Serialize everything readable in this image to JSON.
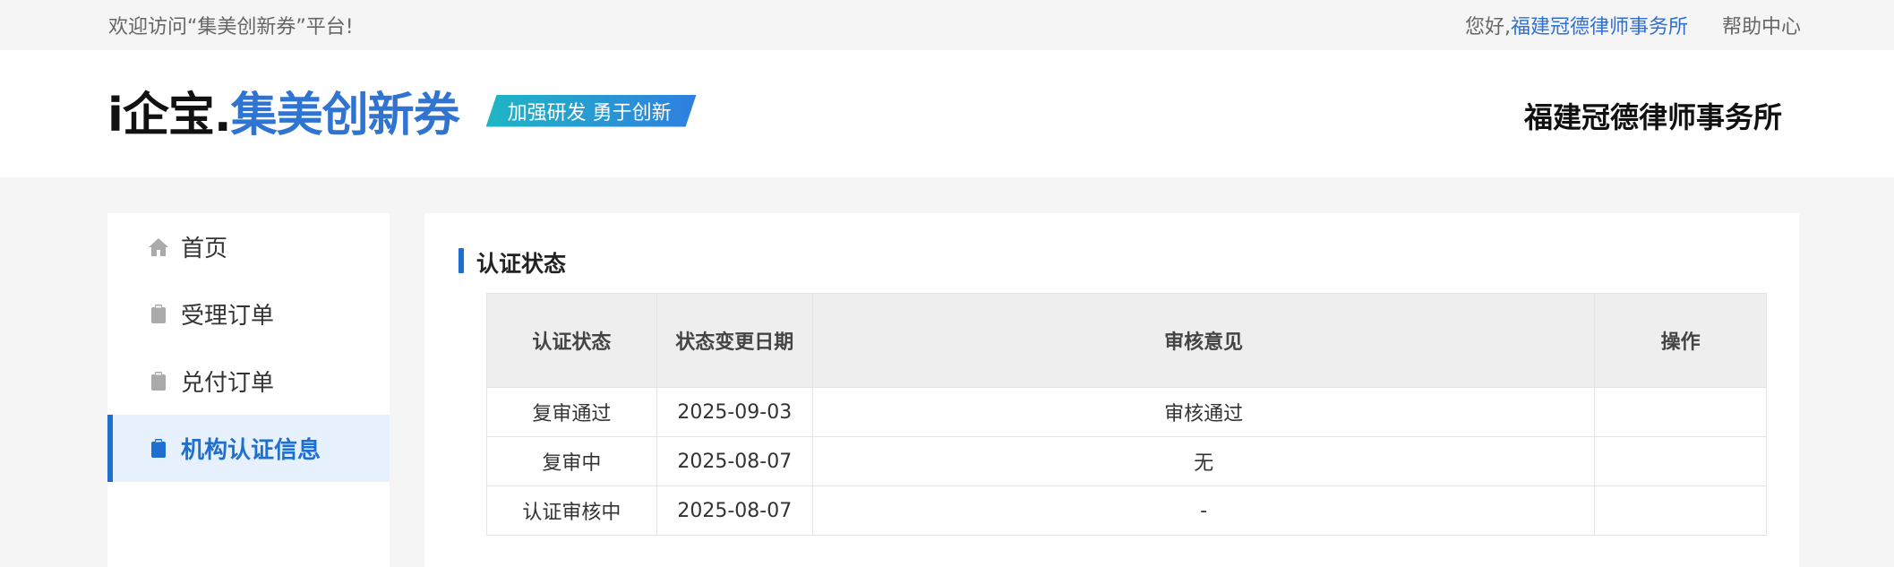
{
  "topbar": {
    "welcome": "欢迎访问“集美创新券”平台!",
    "greeting": "您好,",
    "user_link": "福建冠德律师事务所",
    "help": "帮助中心"
  },
  "header": {
    "logo_prefix": "i企宝.",
    "logo_name": "集美创新券",
    "slogan": "加强研发 勇于创新",
    "org_name": "福建冠德律师事务所"
  },
  "sidebar": {
    "items": [
      {
        "label": "首页",
        "icon": "home-icon",
        "active": false
      },
      {
        "label": "受理订单",
        "icon": "clipboard-icon",
        "active": false
      },
      {
        "label": "兑付订单",
        "icon": "clipboard-icon",
        "active": false
      },
      {
        "label": "机构认证信息",
        "icon": "clipboard-icon",
        "active": true
      }
    ]
  },
  "main": {
    "section_title": "认证状态",
    "table": {
      "headers": [
        "认证状态",
        "状态变更日期",
        "审核意见",
        "操作"
      ],
      "rows": [
        [
          "复审通过",
          "2025-09-03",
          "审核通过",
          ""
        ],
        [
          "复审中",
          "2025-08-07",
          "无",
          ""
        ],
        [
          "认证审核中",
          "2025-08-07",
          "-",
          ""
        ]
      ]
    }
  },
  "colors": {
    "accent": "#1f6fd0",
    "active_bg": "#e6f1fd",
    "link": "#2f6fd1"
  }
}
